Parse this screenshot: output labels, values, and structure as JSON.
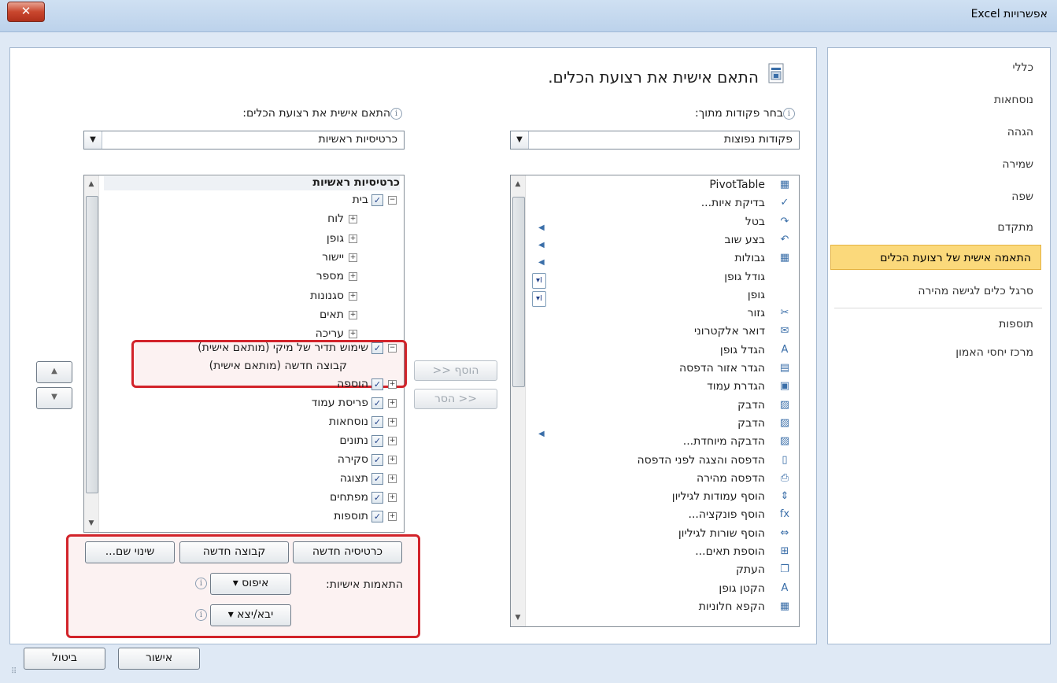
{
  "window": {
    "title": "אפשרויות Excel",
    "close_label": "✕"
  },
  "nav": {
    "items": [
      "כללי",
      "נוסחאות",
      "הגהה",
      "שמירה",
      "שפה",
      "מתקדם",
      "התאמה אישית של רצועת הכלים",
      "סרגל כלים לגישה מהירה",
      "תוספות",
      "מרכז יחסי האמון"
    ],
    "selected": "התאמה אישית של רצועת הכלים"
  },
  "header": {
    "title": "התאם אישית את רצועת הכלים."
  },
  "left_source": {
    "label": "בחר פקודות מתוך:",
    "combo_value": "פקודות נפוצות",
    "commands": [
      "PivotTable",
      "בדיקת איות...",
      "בטל",
      "בצע שוב",
      "גבולות",
      "גודל גופן",
      "גופן",
      "גזור",
      "דואר אלקטרוני",
      "הגדל גופן",
      "הגדר אזור הדפסה",
      "הגדרת עמוד",
      "הדבק",
      "הדבק",
      "הדבקה מיוחדת...",
      "הדפסה והצגה לפני הדפסה",
      "הדפסה מהירה",
      "הוסף עמודות לגיליון",
      "הוסף פונקציה...",
      "הוסף שורות לגיליון",
      "הוספת תאים...",
      "העתק",
      "הקטן גופן",
      "הקפא חלוניות"
    ],
    "icons": [
      "pivot-icon",
      "spell-icon",
      "undo-icon",
      "redo-icon",
      "borders-icon",
      "",
      "",
      "cut-icon",
      "email-icon",
      "grow-font-icon",
      "print-area-icon",
      "page-setup-icon",
      "paste-icon",
      "paste-icon",
      "paste-special-icon",
      "print-preview-icon",
      "quick-print-icon",
      "insert-columns-icon",
      "function-icon",
      "insert-rows-icon",
      "insert-cells-icon",
      "copy-icon",
      "shrink-font-icon",
      "freeze-icon"
    ],
    "icon_glyphs": [
      "▦",
      "✓",
      "↷",
      "↶",
      "▦",
      "",
      "",
      "✂",
      "✉",
      "A",
      "▤",
      "▣",
      "▨",
      "▨",
      "▨",
      "▯",
      "⎙",
      "⇕",
      "fx",
      "⇔",
      "⊞",
      "❐",
      "A",
      "▦"
    ]
  },
  "right_target": {
    "label": "התאם אישית את רצועת הכלים:",
    "combo_value": "כרטיסיות ראשיות",
    "tree_header": "כרטיסיות ראשיות",
    "tab_home": "בית",
    "groups": [
      "לוח",
      "גופן",
      "יישור",
      "מספר",
      "סגנונות",
      "תאים",
      "עריכה"
    ],
    "custom_group_line1": "שימוש תדיר של  מיקי (מותאם אישית)",
    "custom_group_line2": "קבוצה חדשה (מותאם אישית)",
    "tabs": [
      "הוספה",
      "פריסת עמוד",
      "נוסחאות",
      "נתונים",
      "סקירה",
      "תצוגה",
      "מפתחים",
      "תוספות"
    ]
  },
  "middle": {
    "add_label": "הוסף <<",
    "remove_label": "<< הסר"
  },
  "actions": {
    "new_tab": "כרטיסיה חדשה",
    "new_group": "קבוצה חדשה",
    "rename": "שינוי שם...",
    "customizations_label": "התאמות אישיות:",
    "reset": "איפוס ▾",
    "import_export": "יבא/יצא ▾"
  },
  "footer": {
    "ok": "אישור",
    "cancel": "ביטול"
  },
  "colors": {
    "selected_nav": "#fbd97b",
    "highlight": "#d2232a",
    "client_bg": "#dfe9f5"
  }
}
